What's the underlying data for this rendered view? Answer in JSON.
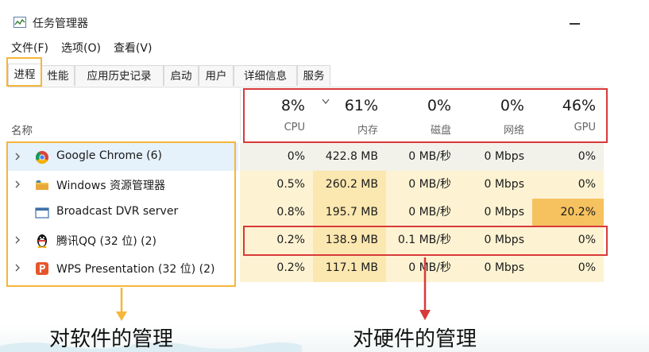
{
  "window": {
    "title": "任务管理器",
    "minimize_icon": "minimize-icon"
  },
  "menu": [
    "文件(F)",
    "选项(O)",
    "查看(V)"
  ],
  "tabs": [
    "进程",
    "性能",
    "应用历史记录",
    "启动",
    "用户",
    "详细信息",
    "服务"
  ],
  "active_tab": "进程",
  "header": {
    "name": "名称",
    "columns": [
      {
        "pct": "8%",
        "label": "CPU"
      },
      {
        "pct": "61%",
        "label": "内存"
      },
      {
        "pct": "0%",
        "label": "磁盘"
      },
      {
        "pct": "0%",
        "label": "网络"
      },
      {
        "pct": "46%",
        "label": "GPU"
      }
    ]
  },
  "processes": [
    {
      "name": "Google Chrome (6)",
      "icon": "chrome-icon",
      "cpu": "0%",
      "mem": "422.8 MB",
      "disk": "0 MB/秒",
      "net": "0 Mbps",
      "gpu": "0%",
      "expandable": true
    },
    {
      "name": "Windows 资源管理器",
      "icon": "folder-icon",
      "cpu": "0.5%",
      "mem": "260.2 MB",
      "disk": "0 MB/秒",
      "net": "0 Mbps",
      "gpu": "0%",
      "expandable": true
    },
    {
      "name": "Broadcast DVR server",
      "icon": "window-icon",
      "cpu": "0.8%",
      "mem": "195.7 MB",
      "disk": "0 MB/秒",
      "net": "0 Mbps",
      "gpu": "20.2%",
      "expandable": false
    },
    {
      "name": "腾讯QQ (32 位) (2)",
      "icon": "qq-penguin-icon",
      "cpu": "0.2%",
      "mem": "138.9 MB",
      "disk": "0.1 MB/秒",
      "net": "0 Mbps",
      "gpu": "0%",
      "expandable": true
    },
    {
      "name": "WPS Presentation (32 位) (2)",
      "icon": "wps-presentation-icon",
      "cpu": "0.2%",
      "mem": "117.1 MB",
      "disk": "0 MB/秒",
      "net": "0 Mbps",
      "gpu": "0%",
      "expandable": true
    }
  ],
  "annotations": {
    "software_caption": "对软件的管理",
    "hardware_caption": "对硬件的管理",
    "box_color_software": "#f5b63a",
    "box_color_hardware": "#d83a3a"
  },
  "heat_colors": {
    "light": "#fdf3d3",
    "medium": "#fbe7b0",
    "strong": "#f9d98b",
    "hot": "#f6c25f"
  }
}
